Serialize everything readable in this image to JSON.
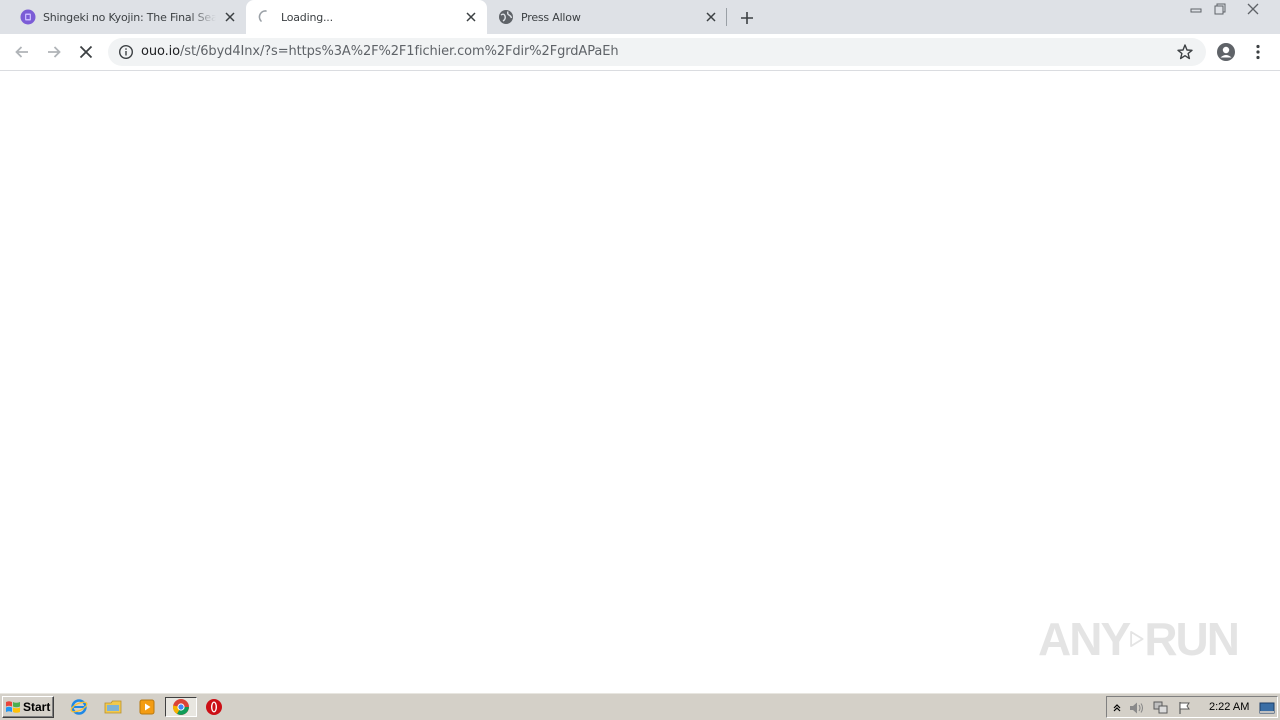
{
  "tabs": [
    {
      "title": "Shingeki no Kyojin: The Final Season",
      "favicon": "site-favicon-purple"
    },
    {
      "title": "Loading...",
      "favicon": "loading-spinner-icon"
    },
    {
      "title": "Press Allow",
      "favicon": "globe-icon"
    }
  ],
  "omnibox": {
    "host": "ouo.io",
    "path": "/st/6byd4Inx/?s=https%3A%2F%2F1fichier.com%2Fdir%2FgrdAPaEh"
  },
  "watermark": {
    "text_left": "ANY",
    "text_right": "RUN"
  },
  "taskbar": {
    "start_label": "Start",
    "clock": "2:22 AM"
  },
  "colors": {
    "tab_strip": "#dee1e6",
    "active_tab": "#ffffff",
    "omnibox": "#f1f3f4",
    "taskbar": "#d4d0c8",
    "favicon_purple": "#7b5cd6"
  }
}
